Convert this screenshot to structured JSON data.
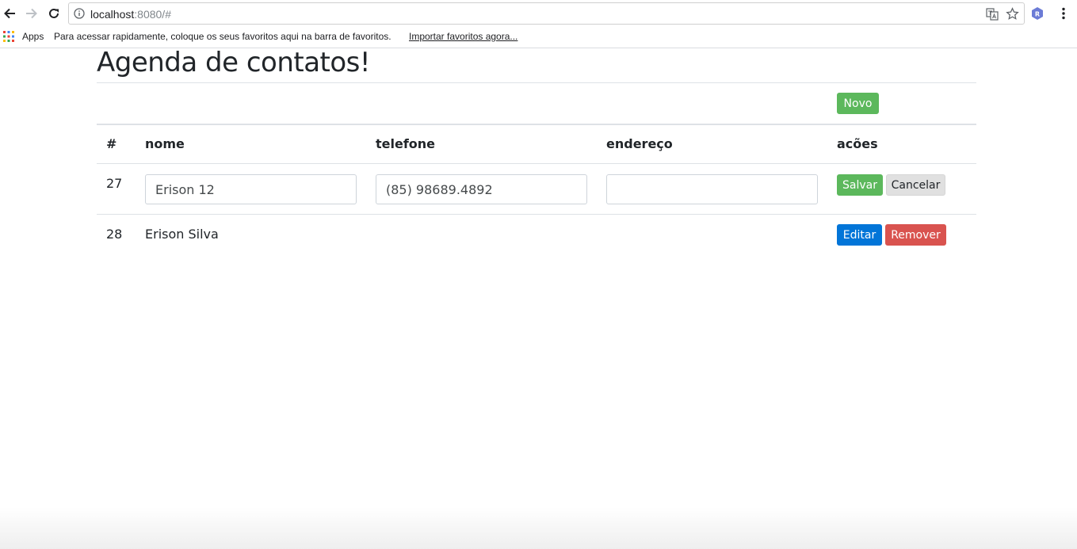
{
  "browser": {
    "url_host": "localhost",
    "url_rest": ":8080/#",
    "apps_label": "Apps",
    "bookmarks_hint": "Para acessar rapidamente, coloque os seus favoritos aqui na barra de favoritos.",
    "bookmarks_import": "Importar favoritos agora...",
    "extension_badge": "R"
  },
  "page": {
    "title": "Agenda de contatos!",
    "new_button": "Novo"
  },
  "table": {
    "headers": [
      "#",
      "nome",
      "telefone",
      "endereço",
      "acões"
    ],
    "rows": [
      {
        "id": "27",
        "editing": true,
        "nome": "Erison 12",
        "telefone": "(85) 98689.4892",
        "endereco": "",
        "actions": [
          "Salvar",
          "Cancelar"
        ]
      },
      {
        "id": "28",
        "editing": false,
        "nome": "Erison Silva",
        "telefone": "",
        "endereco": "",
        "actions": [
          "Editar",
          "Remover"
        ]
      }
    ]
  },
  "colors": {
    "success": "#5cb85c",
    "primary": "#0275d8",
    "danger": "#d9534f",
    "secondary": "#e0e0e0"
  }
}
